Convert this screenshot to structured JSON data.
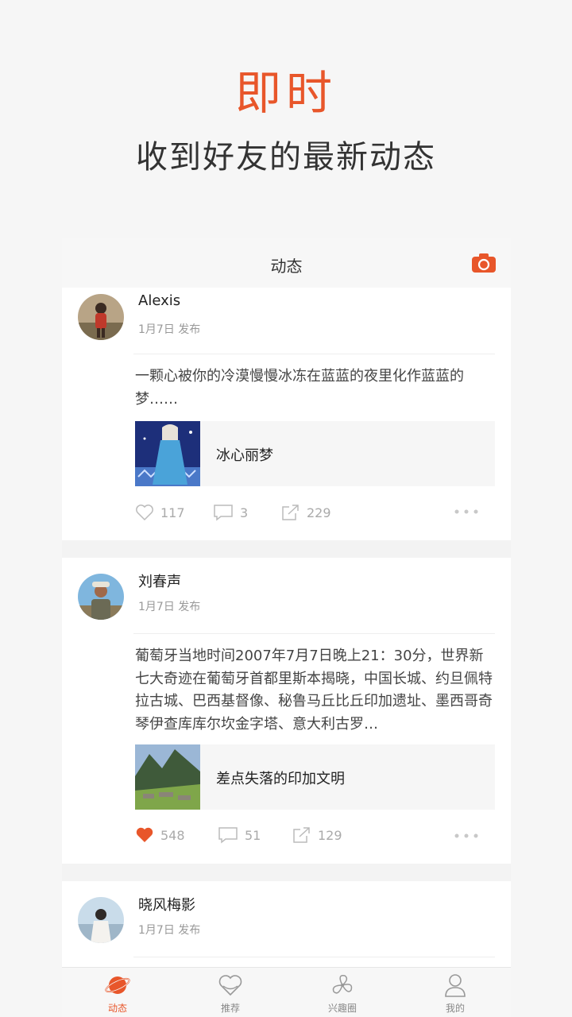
{
  "hero": {
    "title": "即时",
    "subtitle": "收到好友的最新动态"
  },
  "navbar": {
    "title": "动态",
    "camera_icon": "camera-icon"
  },
  "colors": {
    "accent": "#e8562a",
    "like_active": "#e8562a",
    "muted": "#aaaaaa"
  },
  "posts": [
    {
      "username": "Alexis",
      "date": "1月7日 发布",
      "text": "一颗心被你的冷漠慢慢冰冻在蓝蓝的夜里化作蓝蓝的梦……",
      "link_title": "冰心丽梦",
      "likes": "117",
      "comments": "3",
      "shares": "229",
      "liked": false
    },
    {
      "username": "刘春声",
      "date": "1月7日 发布",
      "text": "葡萄牙当地时间2007年7月7日晚上21：30分，世界新七大奇迹在葡萄牙首都里斯本揭晓，中国长城、约旦佩特拉古城、巴西基督像、秘鲁马丘比丘印加遗址、墨西哥奇琴伊查库库尔坎金字塔、意大利古罗…",
      "link_title": "差点失落的印加文明",
      "likes": "548",
      "comments": "51",
      "shares": "129",
      "liked": true
    },
    {
      "username": "晓风梅影",
      "date": "1月7日 发布"
    }
  ],
  "tabs": [
    {
      "label": "动态",
      "icon": "planet-icon",
      "active": true
    },
    {
      "label": "推荐",
      "icon": "heart-icon",
      "active": false
    },
    {
      "label": "兴趣圈",
      "icon": "pinwheel-icon",
      "active": false
    },
    {
      "label": "我的",
      "icon": "person-icon",
      "active": false
    }
  ]
}
